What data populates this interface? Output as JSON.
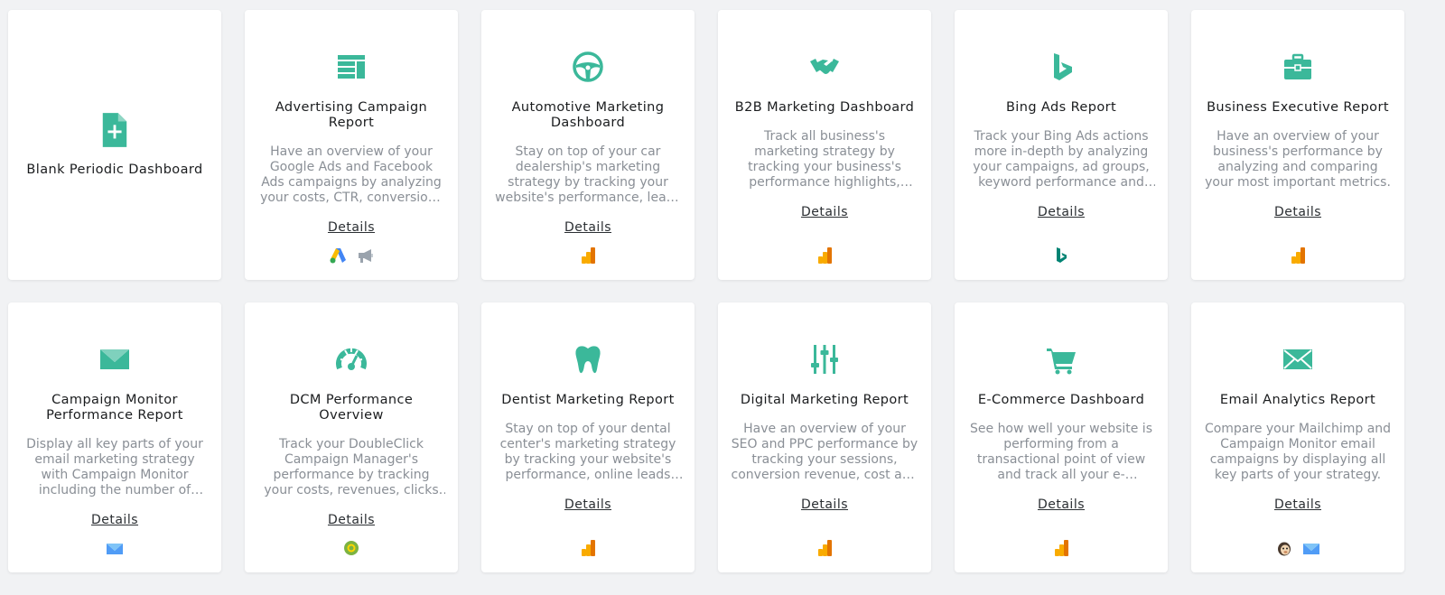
{
  "colors": {
    "accent": "#3bb89a",
    "background": "#f1f2f4",
    "card": "#ffffff"
  },
  "cards": [
    {
      "title": "Blank Periodic Dashboard",
      "icon": "file-plus-icon"
    },
    {
      "title": "Advertising Campaign Report",
      "icon": "layout-icon",
      "desc": "Have an overview of your Google Ads and Facebook Ads campaigns by analyzing your costs, CTR, conversions and more.",
      "details": "Details",
      "sources": [
        "google-ads-icon",
        "megaphone-icon"
      ]
    },
    {
      "title": "Automotive Marketing Dashboard",
      "icon": "steering-wheel-icon",
      "desc": "Stay on top of your car dealership's marketing strategy by tracking your website's performance, leads and more.",
      "details": "Details",
      "sources": [
        "google-analytics-icon"
      ]
    },
    {
      "title": "B2B Marketing Dashboard",
      "icon": "handshake-icon",
      "desc": "Track all business's marketing strategy by tracking your business's performance highlights, leads and more.",
      "details": "Details",
      "sources": [
        "google-analytics-icon"
      ]
    },
    {
      "title": "Bing Ads Report",
      "icon": "bing-icon",
      "desc": "Track your Bing Ads actions more in-depth by analyzing your campaigns, ad groups, keyword performance and more.",
      "details": "Details",
      "sources": [
        "bing-ads-icon"
      ]
    },
    {
      "title": "Business Executive Report",
      "icon": "briefcase-icon",
      "desc": "Have an overview of your business's performance by analyzing and comparing your most important metrics.",
      "details": "Details",
      "sources": [
        "google-analytics-icon"
      ]
    },
    {
      "title": "Campaign Monitor Performance Report",
      "icon": "campaign-monitor-icon",
      "desc": "Display all key parts of your email marketing strategy with Campaign Monitor including the number of subscribers.",
      "details": "Details",
      "sources": [
        "campaign-monitor-source-icon"
      ]
    },
    {
      "title": "DCM Performance Overview",
      "icon": "speedometer-icon",
      "desc": "Track your DoubleClick Campaign Manager's performance by tracking your costs, revenues, clicks and more.",
      "details": "Details",
      "sources": [
        "doubleclick-icon"
      ]
    },
    {
      "title": "Dentist Marketing Report",
      "icon": "tooth-icon",
      "desc": "Stay on top of your dental center's marketing strategy by tracking your website's performance, online leads and more.",
      "details": "Details",
      "sources": [
        "google-analytics-icon"
      ]
    },
    {
      "title": "Digital Marketing Report",
      "icon": "sliders-icon",
      "desc": "Have an overview of your SEO and PPC performance by tracking your sessions, conversion revenue, cost and more.",
      "details": "Details",
      "sources": [
        "google-analytics-icon"
      ]
    },
    {
      "title": "E-Commerce Dashboard",
      "icon": "cart-icon",
      "desc": "See how well your website is performing from a transactional point of view and track all your e-commerce metrics.",
      "details": "Details",
      "sources": [
        "google-analytics-icon"
      ]
    },
    {
      "title": "Email Analytics Report",
      "icon": "envelope-icon",
      "desc": "Compare your Mailchimp and Campaign Monitor email campaigns by displaying all key parts of your strategy.",
      "details": "Details",
      "sources": [
        "mailchimp-icon",
        "campaign-monitor-source-icon"
      ]
    }
  ]
}
